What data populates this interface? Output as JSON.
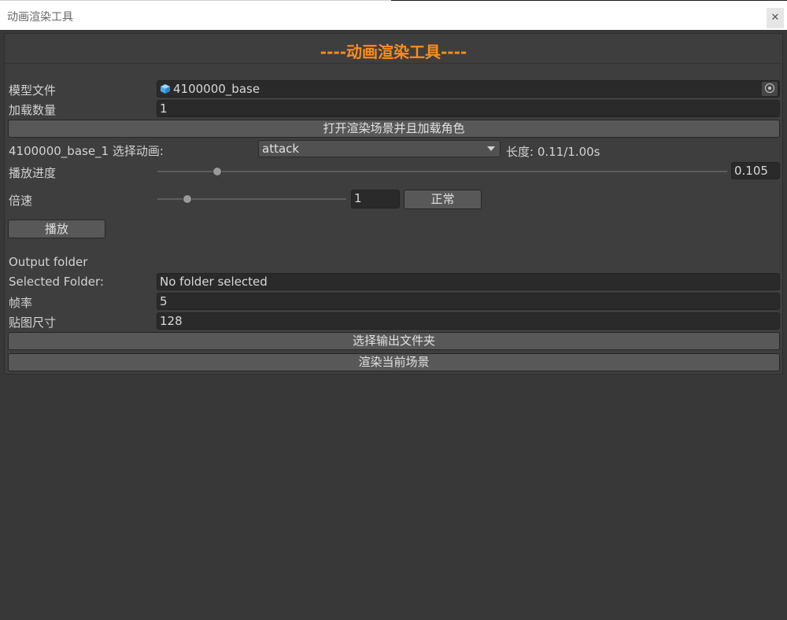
{
  "window": {
    "title": "动画渲染工具",
    "close_glyph": "✕"
  },
  "header": {
    "title": "----动画渲染工具----",
    "accent_color": "#ff8c1a"
  },
  "model_file": {
    "label": "模型文件",
    "value": "4100000_base",
    "icon": "prefab-cube-icon",
    "picker_icon": "object-picker-icon"
  },
  "load_count": {
    "label": "加载数量",
    "value": "1"
  },
  "open_scene_button": "打开渲染场景并且加载角色",
  "animation": {
    "instance_label": "4100000_base_1 选择动画:",
    "selected": "attack",
    "length_label": "长度: 0.11/1.00s"
  },
  "progress": {
    "label": "播放进度",
    "value": "0.105",
    "fraction": 0.105
  },
  "speed": {
    "label": "倍速",
    "value": "1",
    "reset_button": "正常",
    "fraction": 0.16
  },
  "play_button": "播放",
  "output": {
    "section_label": "Output folder",
    "selected_folder_label": "Selected Folder:",
    "selected_folder_value": "No folder selected",
    "frame_rate_label": "帧率",
    "frame_rate_value": "5",
    "texture_size_label": "贴图尺寸",
    "texture_size_value": "128",
    "choose_folder_button": "选择输出文件夹",
    "render_button": "渲染当前场景"
  }
}
